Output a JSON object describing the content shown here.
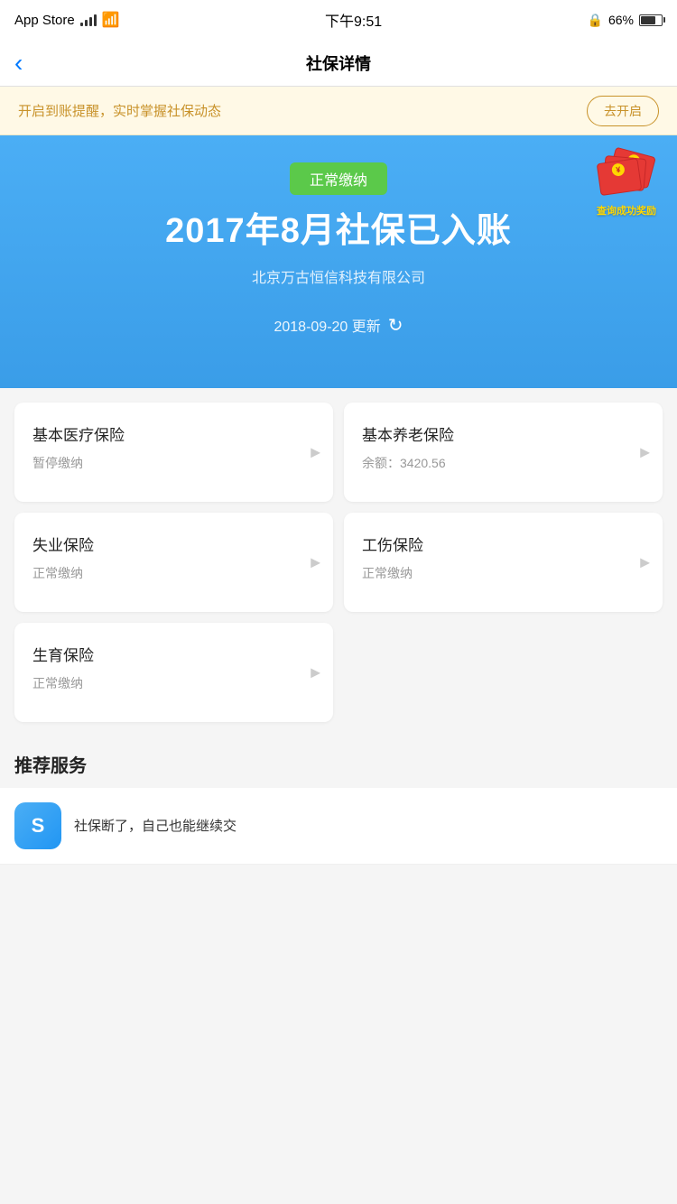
{
  "statusBar": {
    "carrier": "App Store",
    "time": "下午9:51",
    "battery": "66%"
  },
  "navBar": {
    "title": "社保详情",
    "backLabel": "<"
  },
  "banner": {
    "text": "开启到账提醒，实时掌握社保动态",
    "buttonLabel": "去开启"
  },
  "hero": {
    "statusBadge": "正常缴纳",
    "title": "2017年8月社保已入账",
    "company": "北京万古恒信科技有限公司",
    "updateDate": "2018-09-20 更新",
    "rewardText": "查询成功奖励"
  },
  "cards": [
    {
      "id": "card-medical",
      "title": "基本医疗保险",
      "status": "暂停缴纳",
      "balance": null
    },
    {
      "id": "card-pension",
      "title": "基本养老保险",
      "status": "余额：3420.56",
      "balance": "3420.56"
    },
    {
      "id": "card-unemployment",
      "title": "失业保险",
      "status": "正常缴纳",
      "balance": null
    },
    {
      "id": "card-injury",
      "title": "工伤保险",
      "status": "正常缴纳",
      "balance": null
    },
    {
      "id": "card-maternity",
      "title": "生育保险",
      "status": "正常缴纳",
      "balance": null
    }
  ],
  "recommended": {
    "sectionTitle": "推荐服务",
    "items": [
      {
        "iconText": "S",
        "text": "社保断了，自己也能继续交"
      }
    ]
  }
}
